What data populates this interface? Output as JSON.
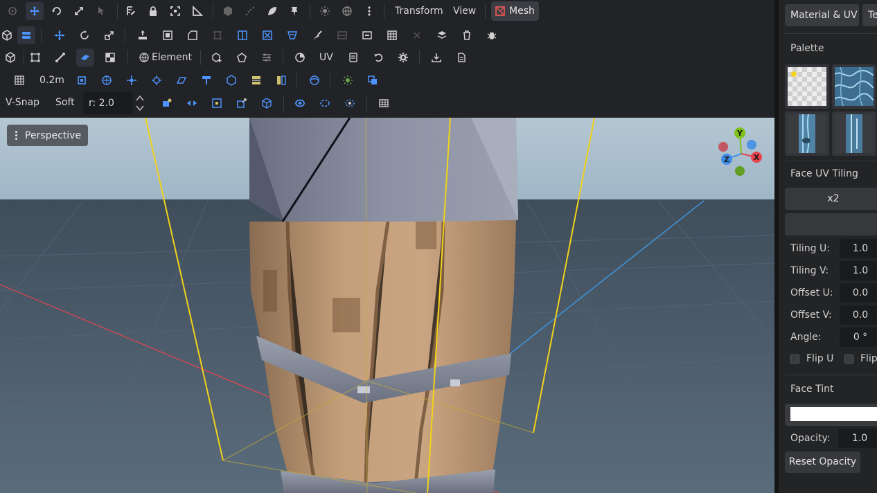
{
  "app": {
    "accent": "#4d94ff",
    "warning": "#e05555"
  },
  "toolbar": {
    "menu_transform": "Transform",
    "menu_view": "View",
    "mode_mesh": "Mesh",
    "element_label": "Element",
    "uv_label": "UV",
    "grid_step": "0.2m",
    "vsnap_label": "V-Snap",
    "soft_label": "Soft",
    "radius_value": "r: 2.0"
  },
  "viewport": {
    "camera_label": "Perspective",
    "gizmo": {
      "y": "Y",
      "x": "X",
      "z": "Z"
    },
    "axis_colors": {
      "x": "#e8434f",
      "y": "#7dc11a",
      "z": "#3d8ce8"
    },
    "selection_color": "#f2d21a"
  },
  "panel": {
    "tab_material": "Material & UV",
    "tab_texture": "Te",
    "palette_title": "Palette",
    "palette_tiles": [
      "checker-texture-icon",
      "water-texture-icon",
      "crystal-texture-icon",
      "crystal-texture-icon-2"
    ],
    "uv_tiling_title": "Face UV Tiling",
    "x2_label": "x2",
    "tiling_u_label": "Tiling U:",
    "tiling_u": "1.0",
    "tiling_v_label": "Tiling V:",
    "tiling_v": "1.0",
    "offset_u_label": "Offset U:",
    "offset_u": "0.0",
    "offset_v_label": "Offset V:",
    "offset_v": "0.0",
    "angle_label": "Angle:",
    "angle": "0 °",
    "flip_u_label": "Flip U",
    "flip_v_label": "Flip",
    "face_tint_title": "Face Tint",
    "tint_color": "#ffffff",
    "opacity_label": "Opacity:",
    "opacity": "1.0",
    "reset_opacity_label": "Reset Opacity"
  }
}
